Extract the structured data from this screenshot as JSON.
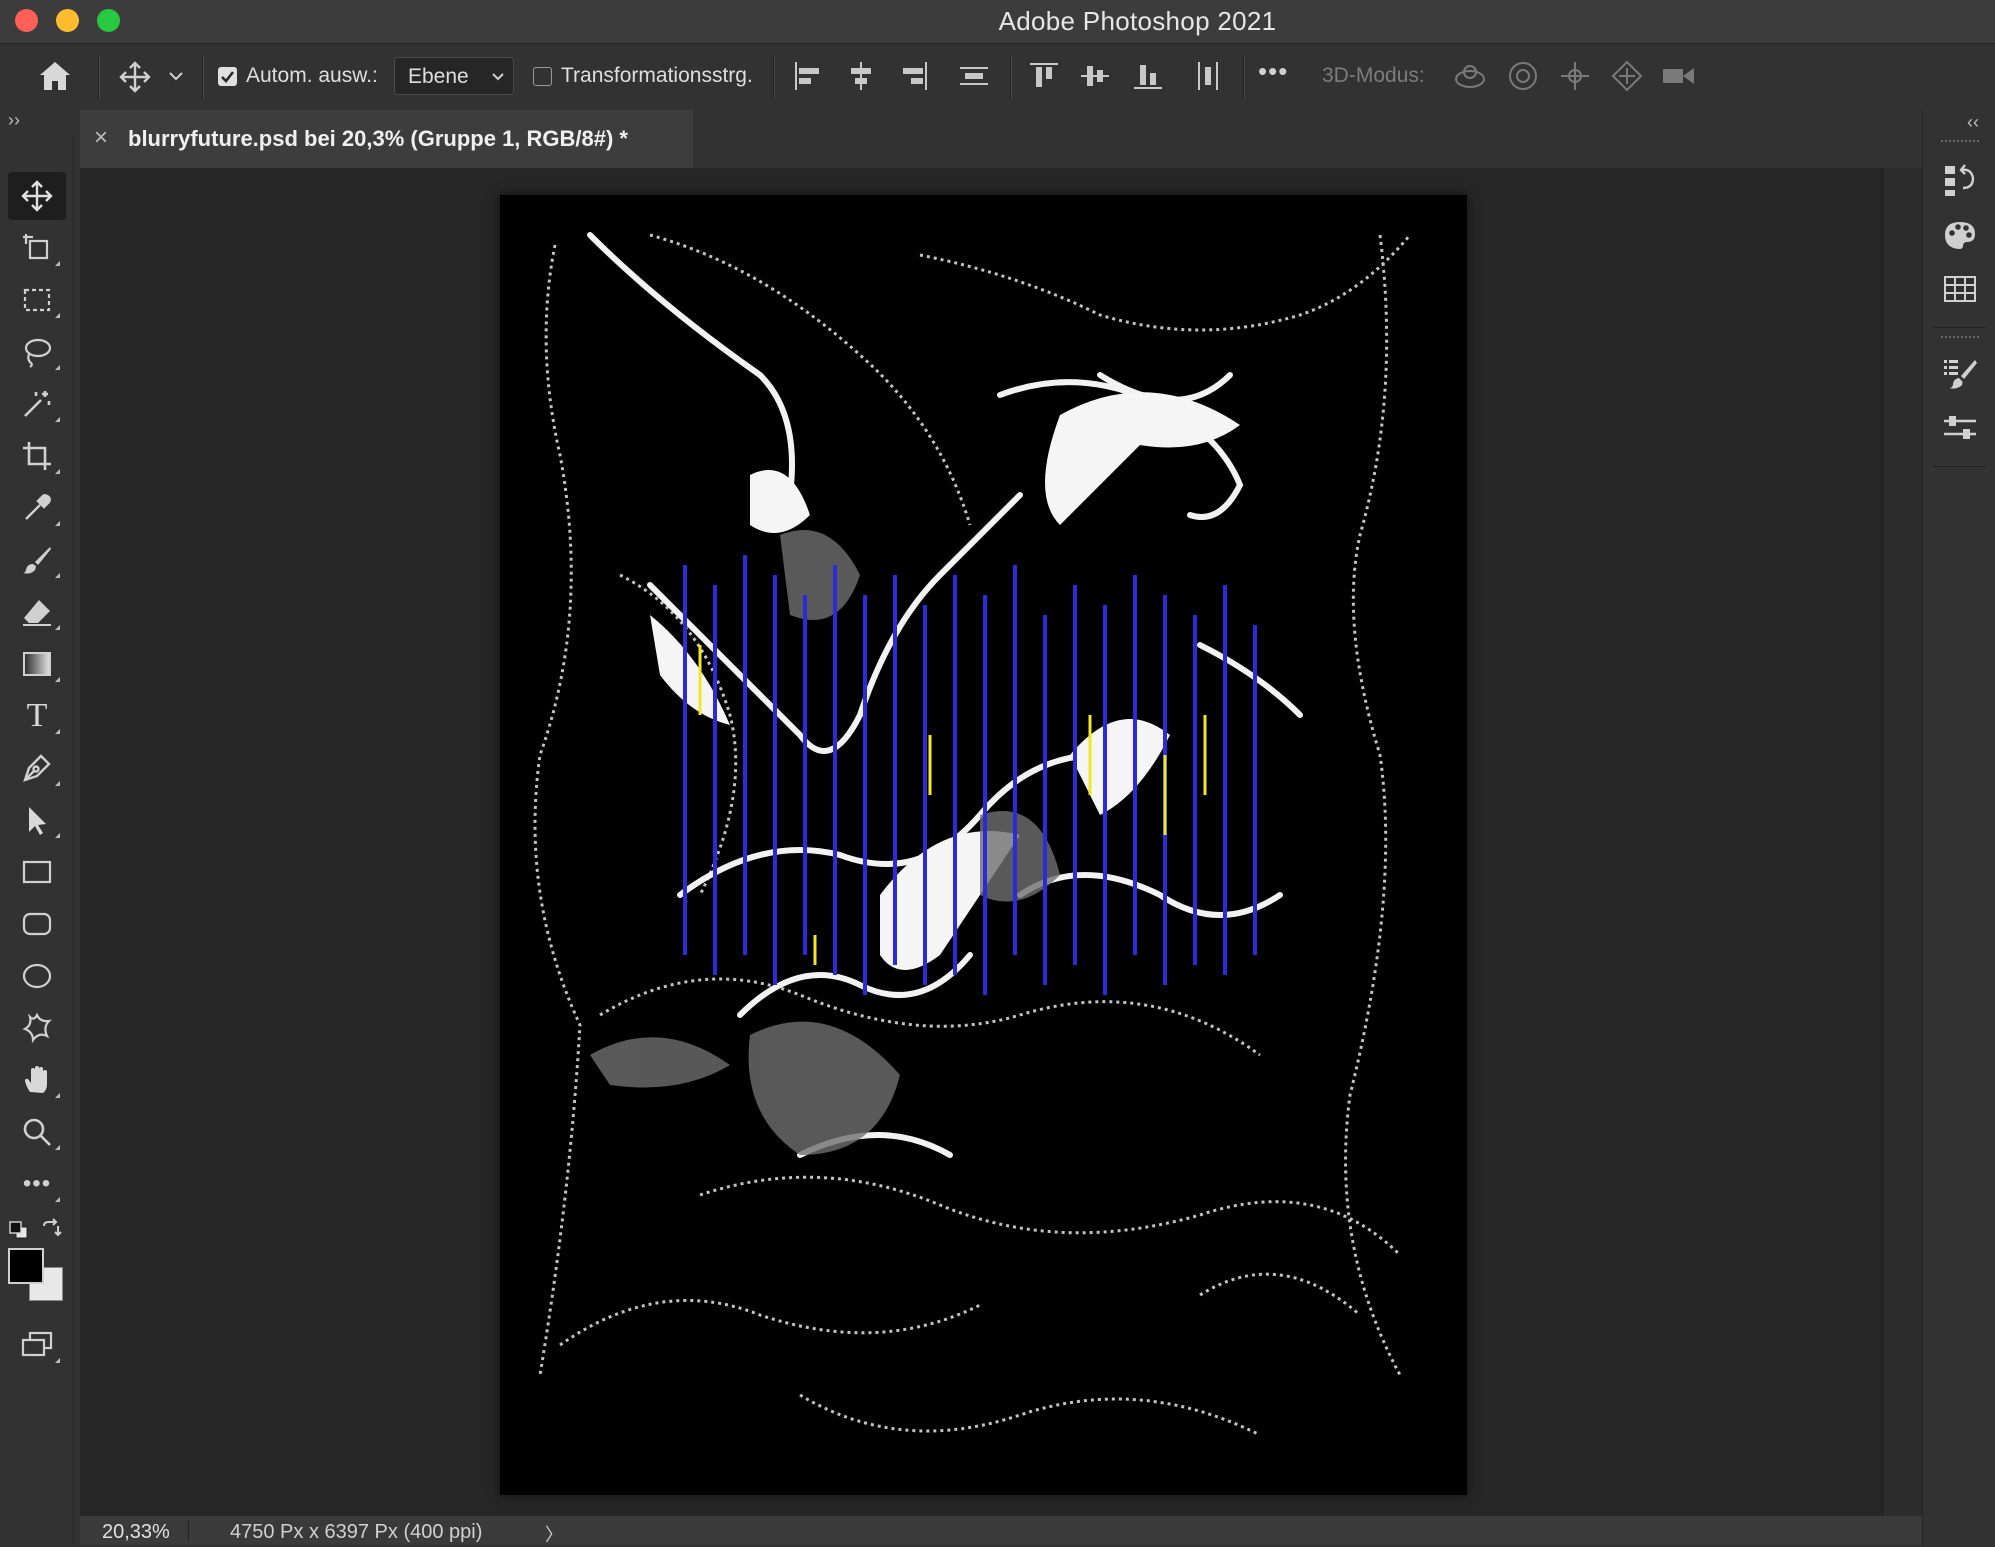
{
  "window": {
    "title": "Adobe Photoshop 2021",
    "traffic_lights": {
      "close": "#fe5f57",
      "minimize": "#febc2e",
      "zoom": "#28c840"
    }
  },
  "options_bar": {
    "home_icon": "home-icon",
    "move_tool_icon": "move-icon",
    "auto_select_checked": true,
    "auto_select_label": "Autom. ausw.:",
    "auto_select_target": "Ebene",
    "transform_controls_checked": false,
    "transform_controls_label": "Transformationsstrg.",
    "more_icon": "•••",
    "mode_3d_label": "3D-Modus:"
  },
  "document_tab": {
    "title": "blurryfuture.psd bei 20,3% (Gruppe 1, RGB/8#) *",
    "close_glyph": "×"
  },
  "toolbar": {
    "tools": [
      "move-tool",
      "artboard-tool",
      "rectangular-marquee-tool",
      "lasso-tool",
      "magic-wand-tool",
      "crop-tool",
      "eyedropper-tool",
      "brush-tool",
      "eraser-tool",
      "gradient-tool",
      "type-tool",
      "pen-tool",
      "path-selection-tool",
      "rectangle-tool",
      "rounded-rectangle-tool",
      "ellipse-tool",
      "custom-shape-tool",
      "hand-tool",
      "zoom-tool",
      "edit-toolbar"
    ],
    "type_tool_glyph": "T",
    "more_glyph": "•••",
    "foreground_color": "#000000",
    "background_color": "#e8e8e8"
  },
  "panels_collapse": {
    "left": "››",
    "right": "‹‹"
  },
  "status_bar": {
    "zoom": "20,33%",
    "doc_size": "4750 Px x 6397 Px (400 ppi)",
    "arrow": "〉"
  },
  "canvas": {
    "background": "#000000",
    "accent_colors": {
      "stroke": "#ffffff",
      "line_blue": "#2b2bd9",
      "line_yellow": "#f0e62a"
    }
  }
}
